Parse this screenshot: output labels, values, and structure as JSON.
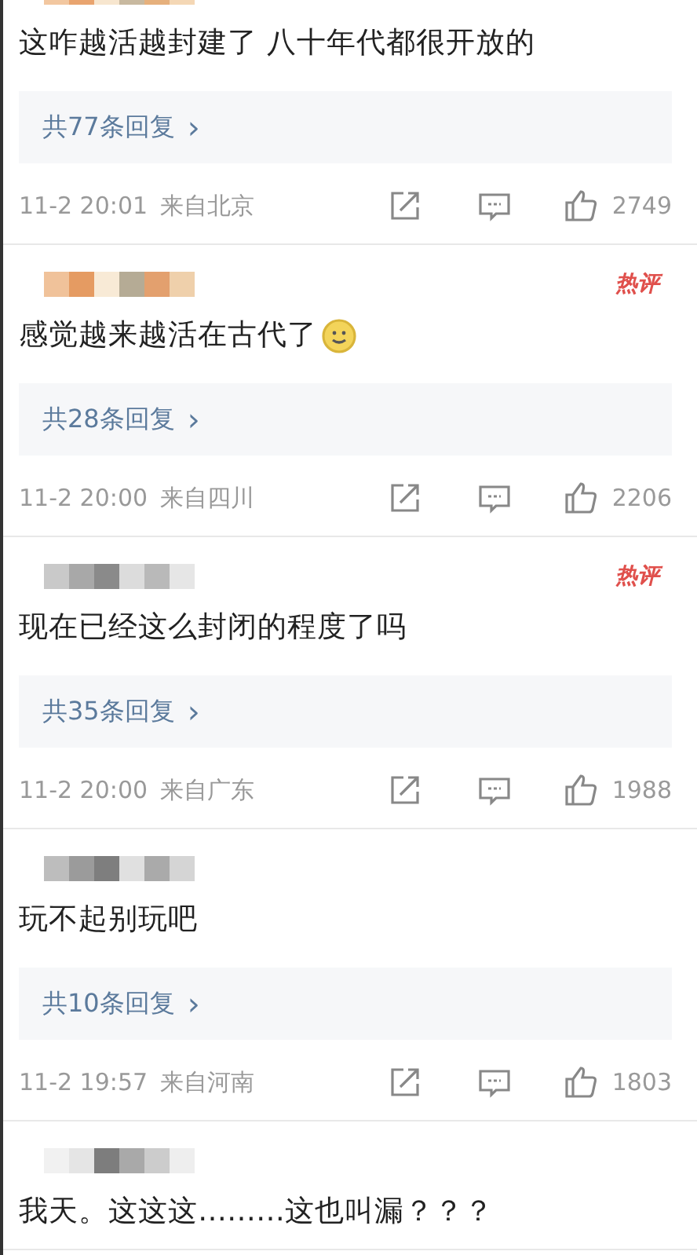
{
  "comments": [
    {
      "text": "这咋越活越封建了 八十年代都很开放的",
      "has_emoji": false,
      "replies": "共77条回复",
      "chevron": "›",
      "time": "11-2 20:01",
      "location": "来自北京",
      "likes": "2749"
    },
    {
      "tag": "热评",
      "text": "感觉越来越活在古代了",
      "has_emoji": true,
      "replies": "共28条回复",
      "chevron": "›",
      "time": "11-2 20:00",
      "location": "来自四川",
      "likes": "2206"
    },
    {
      "tag": "热评",
      "text": "现在已经这么封闭的程度了吗",
      "has_emoji": false,
      "replies": "共35条回复",
      "chevron": "›",
      "time": "11-2 20:00",
      "location": "来自广东",
      "likes": "1988"
    },
    {
      "text": "玩不起别玩吧",
      "has_emoji": false,
      "replies": "共10条回复",
      "chevron": "›",
      "time": "11-2 19:57",
      "location": "来自河南",
      "likes": "1803"
    },
    {
      "text": "我天。这这这………这也叫漏？？？",
      "has_emoji": false
    }
  ]
}
